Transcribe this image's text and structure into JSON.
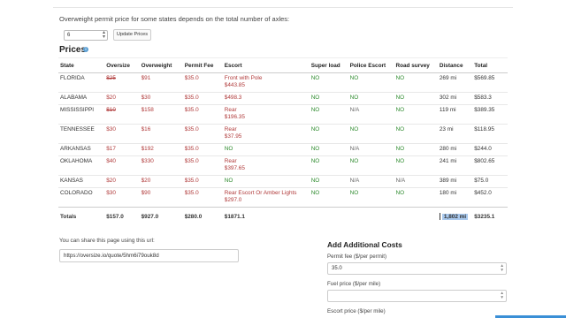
{
  "intro_text": "Overweight permit price for some states depends on the total number of axles:",
  "axles": {
    "value": "6"
  },
  "update_button_label": "Update Prices",
  "prices_title": "Prices",
  "info_icon": "info-circle-icon",
  "table": {
    "headers": [
      "State",
      "Oversize",
      "Overweight",
      "Permit Fee",
      "Escort",
      "Super load",
      "Police Escort",
      "Road survey",
      "Distance",
      "Total"
    ],
    "rows": [
      {
        "state": "FLORIDA",
        "oversize": "$25",
        "oversize_struck": true,
        "overweight": "$91",
        "permit_fee": "$35.0",
        "escort": [
          "Front with Pole",
          "$443.85"
        ],
        "super_load": "NO",
        "police_escort": "NO",
        "road_survey": "NO",
        "distance": "269 mi",
        "total": "$569.85"
      },
      {
        "state": "ALABAMA",
        "oversize": "$20",
        "oversize_struck": false,
        "overweight": "$30",
        "permit_fee": "$35.0",
        "escort": [
          "$498.3"
        ],
        "super_load": "NO",
        "police_escort": "NO",
        "road_survey": "NO",
        "distance": "302 mi",
        "total": "$583.3"
      },
      {
        "state": "MISSISSIPPI",
        "oversize": "$10",
        "oversize_struck": true,
        "overweight": "$158",
        "permit_fee": "$35.0",
        "escort": [
          "Rear",
          "$196.35"
        ],
        "super_load": "NO",
        "police_escort": "N/A",
        "road_survey": "NO",
        "distance": "119 mi",
        "total": "$389.35"
      },
      {
        "state": "TENNESSEE",
        "oversize": "$30",
        "oversize_struck": false,
        "overweight": "$16",
        "permit_fee": "$35.0",
        "escort": [
          "Rear",
          "$37.95"
        ],
        "super_load": "NO",
        "police_escort": "NO",
        "road_survey": "NO",
        "distance": "23 mi",
        "total": "$118.95"
      },
      {
        "state": "ARKANSAS",
        "oversize": "$17",
        "oversize_struck": false,
        "overweight": "$192",
        "permit_fee": "$35.0",
        "escort": [
          "NO"
        ],
        "super_load": "NO",
        "police_escort": "N/A",
        "road_survey": "NO",
        "distance": "280 mi",
        "total": "$244.0"
      },
      {
        "state": "OKLAHOMA",
        "oversize": "$40",
        "oversize_struck": false,
        "overweight": "$330",
        "permit_fee": "$35.0",
        "escort": [
          "Rear",
          "$397.65"
        ],
        "super_load": "NO",
        "police_escort": "NO",
        "road_survey": "NO",
        "distance": "241 mi",
        "total": "$802.65"
      },
      {
        "state": "KANSAS",
        "oversize": "$20",
        "oversize_struck": false,
        "overweight": "$20",
        "permit_fee": "$35.0",
        "escort": [
          "NO"
        ],
        "super_load": "NO",
        "police_escort": "N/A",
        "road_survey": "N/A",
        "distance": "389 mi",
        "total": "$75.0"
      },
      {
        "state": "COLORADO",
        "oversize": "$30",
        "oversize_struck": false,
        "overweight": "$90",
        "permit_fee": "$35.0",
        "escort": [
          "Rear Escort Or Amber Lights",
          "$297.0"
        ],
        "super_load": "NO",
        "police_escort": "NO",
        "road_survey": "NO",
        "distance": "180 mi",
        "total": "$452.0"
      }
    ],
    "totals": {
      "label": "Totals",
      "oversize": "$157.0",
      "overweight": "$927.0",
      "permit_fee": "$280.0",
      "escort": "$1871.1",
      "distance": "1,802 mi",
      "total": "$3235.1"
    }
  },
  "share": {
    "label": "You can share this page using this url:",
    "url": "https://oversize.io/quote/5hm6i79ouk8d"
  },
  "additional_costs": {
    "title": "Add Additional Costs",
    "permit_fee_label": "Permit fee ($/per permit)",
    "permit_fee_value": "35.0",
    "fuel_price_label": "Fuel price ($/per mile)",
    "fuel_price_value": "",
    "escort_price_label": "Escort price ($/per mile)"
  },
  "colors": {
    "link_red": "#b03a3a",
    "yes_no_green": "#2e8b2e",
    "highlight": "#a9c9ee",
    "accent_blue": "#3a8fd6"
  }
}
